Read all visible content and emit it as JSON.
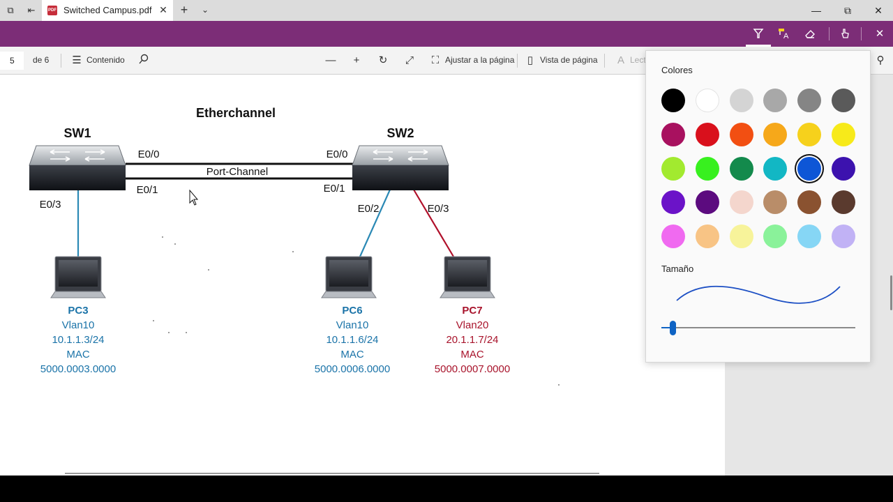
{
  "window": {
    "tab_title": "Switched Campus.pdf",
    "tab_icon": "PDF",
    "new_tab": "+",
    "tab_menu": "⌄",
    "minimize": "—",
    "maximize": "⧉",
    "close": "✕"
  },
  "ink_toolbar": {
    "buttons": [
      "highlighter-pen",
      "text-highlight",
      "eraser",
      "touch-writing",
      "close"
    ]
  },
  "pdf_toolbar": {
    "page_number": "5",
    "page_total": "de 6",
    "contents_label": "Contenido",
    "fit_label": "Ajustar a la página",
    "view_label": "Vista de página",
    "read_label": "Lect"
  },
  "diagram": {
    "title": "Etherchannel",
    "sw1": "SW1",
    "sw2": "SW2",
    "port_channel": "Port-Channel",
    "sw1_e00": "E0/0",
    "sw1_e01": "E0/1",
    "sw1_e03": "E0/3",
    "sw2_e00": "E0/0",
    "sw2_e01": "E0/1",
    "sw2_e02": "E0/2",
    "sw2_e03": "E0/3",
    "link_colors": {
      "vlan10": "#2b89b5",
      "vlan20": "#b0102a",
      "trunk": "#111111"
    },
    "pcs": [
      {
        "name": "PC3",
        "vlan": "Vlan10",
        "ip": "10.1.1.3/24",
        "mac_label": "MAC",
        "mac": "5000.0003.0000",
        "color": "#1a73a8"
      },
      {
        "name": "PC6",
        "vlan": "Vlan10",
        "ip": "10.1.1.6/24",
        "mac_label": "MAC",
        "mac": "5000.0006.0000",
        "color": "#1a73a8"
      },
      {
        "name": "PC7",
        "vlan": "Vlan20",
        "ip": "20.1.1.7/24",
        "mac_label": "MAC",
        "mac": "5000.0007.0000",
        "color": "#a8132b"
      }
    ]
  },
  "color_panel": {
    "colors_heading": "Colores",
    "size_heading": "Tamaño",
    "selected": "#0e56d6",
    "slider_value": 0.05,
    "swatches": [
      [
        "#000000",
        "#ffffff",
        "#d4d4d4",
        "#a8a8a8",
        "#858585",
        "#5a5a5a"
      ],
      [
        "#a8115f",
        "#d9101c",
        "#f24f12",
        "#f6a81a",
        "#f6d11c",
        "#f7ea1a"
      ],
      [
        "#a2ea2f",
        "#38f01f",
        "#138a4c",
        "#12b7c4",
        "#0e56d6",
        "#3c12ae"
      ],
      [
        "#6b13c8",
        "#5c0b7f",
        "#f4d6cd",
        "#b98d69",
        "#8a5230",
        "#5a3a2e"
      ],
      [
        "#f06af0",
        "#f8c485",
        "#f7f39a",
        "#8af29a",
        "#86d6f5",
        "#c1b2f5"
      ]
    ]
  }
}
